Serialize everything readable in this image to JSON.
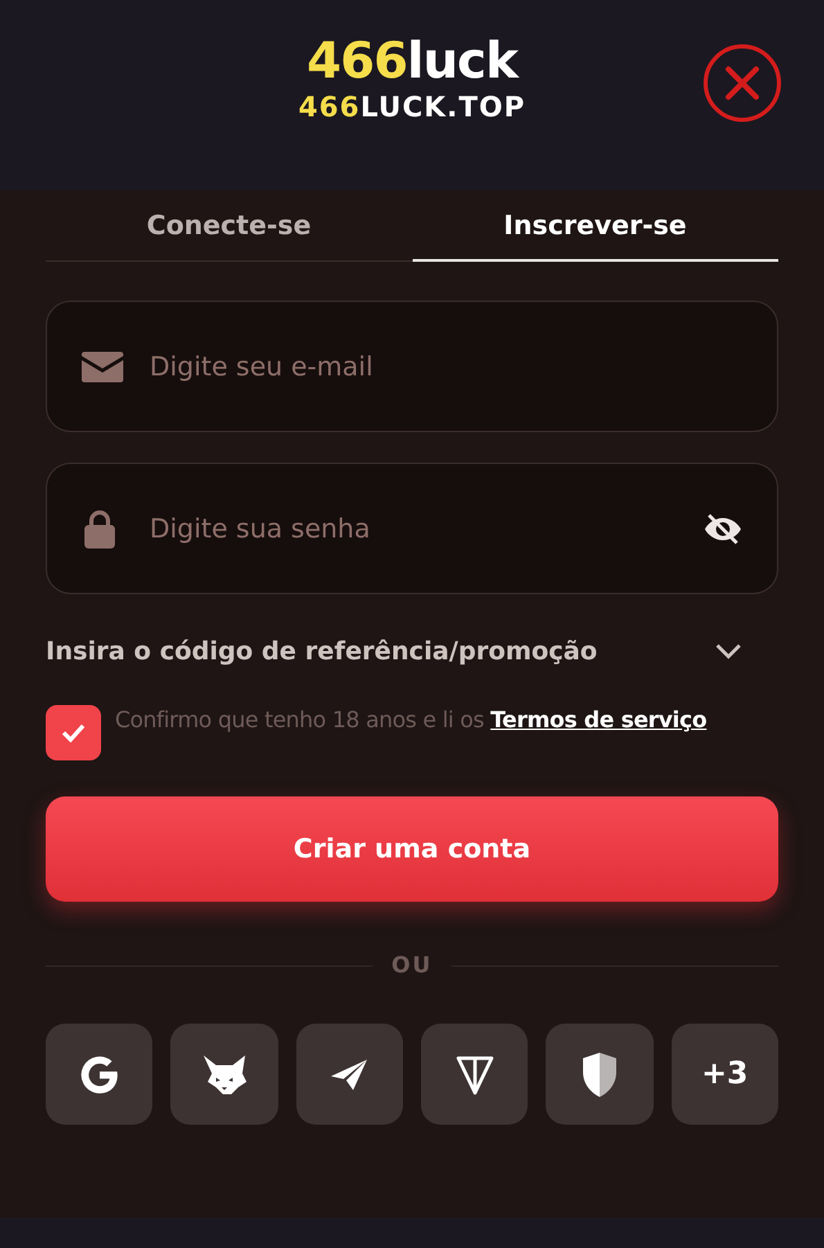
{
  "logo": {
    "title_accent": "466",
    "title_rest": "luck",
    "domain_accent": "466",
    "domain_rest": "LUCK.TOP"
  },
  "tabs": [
    {
      "label": "Conecte-se",
      "selected": false
    },
    {
      "label": "Inscrever-se",
      "selected": true
    }
  ],
  "fields": [
    {
      "kind": "email",
      "placeholder": "Digite seu e-mail"
    },
    {
      "kind": "password",
      "placeholder": "Digite sua senha"
    }
  ],
  "referral": {
    "label": "Insira o código de referência/promoção",
    "expanded": false
  },
  "terms": {
    "checked": true,
    "text": "Confirmo que tenho 18 anos e li os",
    "link": "Termos de serviço"
  },
  "submit": "Criar uma conta",
  "divider": "OU",
  "socials": [
    {
      "kind": "google"
    },
    {
      "kind": "fox"
    },
    {
      "kind": "telegram"
    },
    {
      "kind": "ton"
    },
    {
      "kind": "shield"
    },
    {
      "kind": "more",
      "label": "+3"
    }
  ]
}
